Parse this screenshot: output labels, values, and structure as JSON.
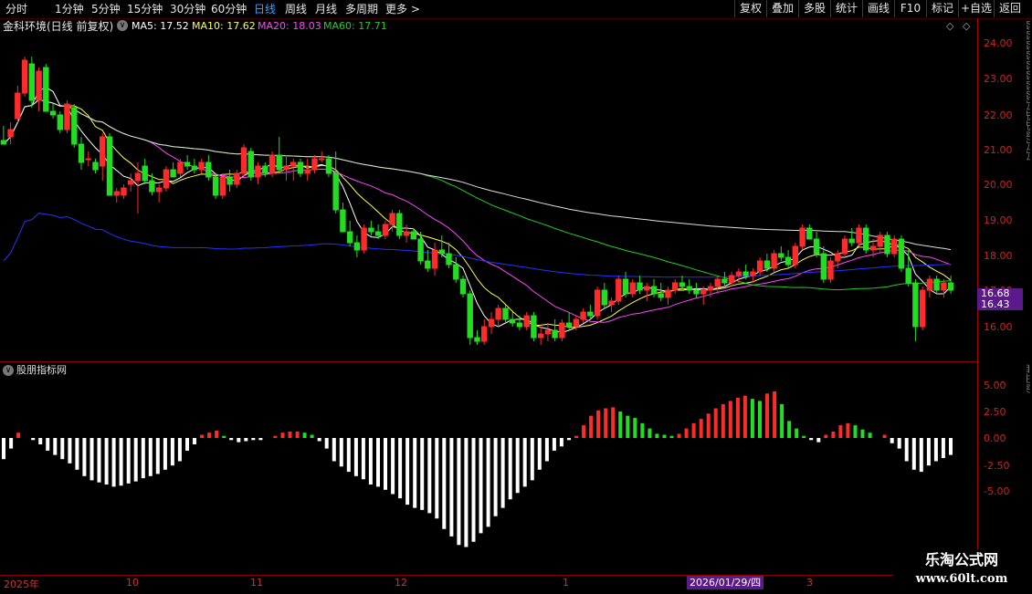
{
  "toolbar": {
    "tabs": [
      "分时",
      "1分钟",
      "5分钟",
      "15分钟",
      "30分钟",
      "60分钟",
      "日线",
      "周线",
      "月线",
      "多周期",
      "更多 >"
    ],
    "active_tab": "日线",
    "right_buttons": [
      "复权",
      "叠加",
      "多股",
      "统计",
      "画线",
      "F10",
      "标记",
      "+自选",
      "返回"
    ]
  },
  "info": {
    "title": "金科环境(日线 前复权)",
    "ma5": "MA5: 17.52",
    "ma10": "MA10: 17.62",
    "ma20": "MA20: 18.03",
    "ma60": "MA60: 17.71"
  },
  "colors": {
    "up": "#ff2a2a",
    "down": "#22dd22",
    "ma5": "#ffffff",
    "ma10": "#ffff44",
    "ma20": "#ff44ff",
    "ma60": "#22cc22",
    "long1": "#dddddd",
    "long2": "#2233ff",
    "axis": "#cc2222"
  },
  "price_axis": [
    "24.00",
    "23.00",
    "22.00",
    "21.00",
    "20.00",
    "19.00",
    "18.00",
    "17.00",
    "16.00"
  ],
  "price_tag": {
    "line1": "16.68",
    "line2": "16.43"
  },
  "indicator": {
    "title": "股朋指标网",
    "axis": [
      "5.00",
      "2.50",
      "0.00",
      "-2.50",
      "-5.00"
    ]
  },
  "x_axis": {
    "labels": [
      "2025年",
      "10",
      "11",
      "12",
      "1",
      "2026/01/29/四",
      "3"
    ]
  },
  "side_text": "套套套套套套套套拉洗洗突拉拉",
  "side_text2": "自注突",
  "logo": {
    "title": "乐淘公式网",
    "url": "www.60lt.com"
  },
  "chart_data": {
    "type": "candlestick",
    "ylim": [
      15.5,
      24.4
    ],
    "candles": [
      [
        21.5,
        21.9,
        21.4,
        21.4
      ],
      [
        21.6,
        22.0,
        21.4,
        21.8
      ],
      [
        22.1,
        23.0,
        22.0,
        22.8
      ],
      [
        22.8,
        23.8,
        22.7,
        23.7
      ],
      [
        23.6,
        23.8,
        22.4,
        22.6
      ],
      [
        22.6,
        23.5,
        22.3,
        23.4
      ],
      [
        23.5,
        23.6,
        22.3,
        22.3
      ],
      [
        22.3,
        22.5,
        22.1,
        22.2
      ],
      [
        22.2,
        22.3,
        21.7,
        21.8
      ],
      [
        21.8,
        22.6,
        21.7,
        22.5
      ],
      [
        22.4,
        22.5,
        21.3,
        21.4
      ],
      [
        21.4,
        21.6,
        20.7,
        20.9
      ],
      [
        21.0,
        21.2,
        20.8,
        21.0
      ],
      [
        20.9,
        21.0,
        20.6,
        20.7
      ],
      [
        20.8,
        21.7,
        20.4,
        21.6
      ],
      [
        21.6,
        21.7,
        20.0,
        20.0
      ],
      [
        20.0,
        20.2,
        19.8,
        20.1
      ],
      [
        20.0,
        20.3,
        19.9,
        20.2
      ],
      [
        20.3,
        20.6,
        20.1,
        20.4
      ],
      [
        20.4,
        20.9,
        19.5,
        20.6
      ],
      [
        20.8,
        21.0,
        20.3,
        20.4
      ],
      [
        20.4,
        20.6,
        20.0,
        20.1
      ],
      [
        20.1,
        20.3,
        19.8,
        20.2
      ],
      [
        20.2,
        20.8,
        20.1,
        20.7
      ],
      [
        20.7,
        20.9,
        20.5,
        20.5
      ],
      [
        20.6,
        21.0,
        20.5,
        20.9
      ],
      [
        20.9,
        21.1,
        20.7,
        20.8
      ],
      [
        20.8,
        21.0,
        20.6,
        20.7
      ],
      [
        20.7,
        21.0,
        20.6,
        20.9
      ],
      [
        20.9,
        21.1,
        20.4,
        20.5
      ],
      [
        20.5,
        20.6,
        19.9,
        20.0
      ],
      [
        20.0,
        20.6,
        19.9,
        20.5
      ],
      [
        20.5,
        20.7,
        20.1,
        20.3
      ],
      [
        20.3,
        20.7,
        20.2,
        20.6
      ],
      [
        20.6,
        21.4,
        20.5,
        21.3
      ],
      [
        21.2,
        21.3,
        20.4,
        20.5
      ],
      [
        20.5,
        20.9,
        20.3,
        20.8
      ],
      [
        20.8,
        20.9,
        20.5,
        20.6
      ],
      [
        20.6,
        21.2,
        20.5,
        21.1
      ],
      [
        21.1,
        21.6,
        20.6,
        20.7
      ],
      [
        20.7,
        21.1,
        20.4,
        20.8
      ],
      [
        20.8,
        21.0,
        20.4,
        20.9
      ],
      [
        20.9,
        21.0,
        20.5,
        20.6
      ],
      [
        20.6,
        21.0,
        20.4,
        20.7
      ],
      [
        20.7,
        21.1,
        20.6,
        21.0
      ],
      [
        21.0,
        21.2,
        20.9,
        21.0
      ],
      [
        21.0,
        21.1,
        20.5,
        20.6
      ],
      [
        20.6,
        21.2,
        19.5,
        19.6
      ],
      [
        19.6,
        19.8,
        19.1,
        19.0
      ],
      [
        19.0,
        19.3,
        18.6,
        18.7
      ],
      [
        18.7,
        18.9,
        18.3,
        18.5
      ],
      [
        18.5,
        19.2,
        18.4,
        19.1
      ],
      [
        19.1,
        19.3,
        18.9,
        19.0
      ],
      [
        19.0,
        19.2,
        18.8,
        18.9
      ],
      [
        18.9,
        19.3,
        18.8,
        19.2
      ],
      [
        19.2,
        19.6,
        19.0,
        19.5
      ],
      [
        19.5,
        19.6,
        18.8,
        18.9
      ],
      [
        18.9,
        19.2,
        18.7,
        19.0
      ],
      [
        19.0,
        19.1,
        18.8,
        18.8
      ],
      [
        18.8,
        19.0,
        18.1,
        18.2
      ],
      [
        18.2,
        18.5,
        17.9,
        18.0
      ],
      [
        18.0,
        18.7,
        17.8,
        18.5
      ],
      [
        18.5,
        18.9,
        18.3,
        18.4
      ],
      [
        18.4,
        18.7,
        18.0,
        18.1
      ],
      [
        18.1,
        18.3,
        17.6,
        17.7
      ],
      [
        17.7,
        17.8,
        17.2,
        17.3
      ],
      [
        17.3,
        17.4,
        15.9,
        16.1
      ],
      [
        16.1,
        16.3,
        15.9,
        16.0
      ],
      [
        16.0,
        16.6,
        15.9,
        16.4
      ],
      [
        16.4,
        16.8,
        16.2,
        16.6
      ],
      [
        16.6,
        17.0,
        16.4,
        16.9
      ],
      [
        16.9,
        17.0,
        16.5,
        16.6
      ],
      [
        16.6,
        16.8,
        16.4,
        16.5
      ],
      [
        16.5,
        16.7,
        16.3,
        16.4
      ],
      [
        16.4,
        16.8,
        16.3,
        16.7
      ],
      [
        16.7,
        16.8,
        16.0,
        16.1
      ],
      [
        16.1,
        16.4,
        15.9,
        16.2
      ],
      [
        16.2,
        16.5,
        16.0,
        16.3
      ],
      [
        16.3,
        16.6,
        16.0,
        16.1
      ],
      [
        16.1,
        16.6,
        16.0,
        16.5
      ],
      [
        16.5,
        16.8,
        16.3,
        16.4
      ],
      [
        16.4,
        16.7,
        16.3,
        16.6
      ],
      [
        16.6,
        16.9,
        16.5,
        16.8
      ],
      [
        16.8,
        17.0,
        16.6,
        16.7
      ],
      [
        16.7,
        17.5,
        16.6,
        17.4
      ],
      [
        17.4,
        17.6,
        16.9,
        17.0
      ],
      [
        17.0,
        17.2,
        16.8,
        17.1
      ],
      [
        17.1,
        17.8,
        17.0,
        17.7
      ],
      [
        17.7,
        17.9,
        17.2,
        17.3
      ],
      [
        17.3,
        17.7,
        17.2,
        17.6
      ],
      [
        17.6,
        17.8,
        17.3,
        17.4
      ],
      [
        17.4,
        17.6,
        17.1,
        17.5
      ],
      [
        17.5,
        17.7,
        17.2,
        17.3
      ],
      [
        17.3,
        17.6,
        17.1,
        17.2
      ],
      [
        17.2,
        17.5,
        17.0,
        17.4
      ],
      [
        17.4,
        17.7,
        17.3,
        17.6
      ],
      [
        17.6,
        17.8,
        17.4,
        17.5
      ],
      [
        17.5,
        17.7,
        17.3,
        17.4
      ],
      [
        17.4,
        17.6,
        17.2,
        17.3
      ],
      [
        17.3,
        17.5,
        17.0,
        17.4
      ],
      [
        17.4,
        17.6,
        17.2,
        17.5
      ],
      [
        17.5,
        17.8,
        17.3,
        17.7
      ],
      [
        17.7,
        17.9,
        17.5,
        17.6
      ],
      [
        17.6,
        17.9,
        17.5,
        17.8
      ],
      [
        17.8,
        18.0,
        17.6,
        17.9
      ],
      [
        17.9,
        18.1,
        17.7,
        17.8
      ],
      [
        17.8,
        18.0,
        17.6,
        17.9
      ],
      [
        17.9,
        18.3,
        17.8,
        18.2
      ],
      [
        18.2,
        18.4,
        17.9,
        18.0
      ],
      [
        18.0,
        18.5,
        17.9,
        18.4
      ],
      [
        18.4,
        18.6,
        18.2,
        18.3
      ],
      [
        18.3,
        18.5,
        18.0,
        18.1
      ],
      [
        18.1,
        18.7,
        18.0,
        18.6
      ],
      [
        18.6,
        19.2,
        18.5,
        19.1
      ],
      [
        19.1,
        19.2,
        18.8,
        18.8
      ],
      [
        18.8,
        19.0,
        18.3,
        18.4
      ],
      [
        18.4,
        18.6,
        17.6,
        17.7
      ],
      [
        17.7,
        18.3,
        17.6,
        18.2
      ],
      [
        18.2,
        18.5,
        18.0,
        18.4
      ],
      [
        18.4,
        18.9,
        18.3,
        18.8
      ],
      [
        18.8,
        19.1,
        18.6,
        18.7
      ],
      [
        18.7,
        19.2,
        18.6,
        19.1
      ],
      [
        19.1,
        19.2,
        18.4,
        18.5
      ],
      [
        18.5,
        18.8,
        18.3,
        18.6
      ],
      [
        18.6,
        19.0,
        18.4,
        18.9
      ],
      [
        18.9,
        19.0,
        18.3,
        18.4
      ],
      [
        18.4,
        18.9,
        18.3,
        18.8
      ],
      [
        18.8,
        18.9,
        17.9,
        18.0
      ],
      [
        18.0,
        18.5,
        17.5,
        17.6
      ],
      [
        17.6,
        17.7,
        16.0,
        16.4
      ],
      [
        16.4,
        17.5,
        16.3,
        17.4
      ],
      [
        17.4,
        17.8,
        17.2,
        17.7
      ],
      [
        17.7,
        17.8,
        17.3,
        17.4
      ],
      [
        17.4,
        17.7,
        17.2,
        17.6
      ],
      [
        17.6,
        17.8,
        17.3,
        17.4
      ]
    ],
    "macd": [
      -2.0,
      -1.0,
      0.5,
      0.0,
      -0.2,
      -0.6,
      -1.2,
      -1.6,
      -2.0,
      -2.4,
      -3.0,
      -3.6,
      -4.0,
      -4.2,
      -4.4,
      -4.6,
      -4.5,
      -4.3,
      -4.1,
      -3.8,
      -3.6,
      -3.4,
      -3.0,
      -2.6,
      -2.2,
      -1.2,
      -0.6,
      0.3,
      0.5,
      0.7,
      0.2,
      -0.2,
      -0.4,
      -0.3,
      -0.2,
      -0.2,
      0.0,
      0.2,
      0.5,
      0.6,
      0.6,
      0.5,
      0.3,
      -0.3,
      -1.0,
      -2.2,
      -2.7,
      -3.2,
      -3.6,
      -3.9,
      -4.4,
      -4.6,
      -4.9,
      -5.3,
      -5.7,
      -6.3,
      -6.6,
      -6.8,
      -7.1,
      -7.6,
      -8.6,
      -9.3,
      -10.1,
      -10.3,
      -9.8,
      -9.0,
      -8.4,
      -7.4,
      -6.6,
      -5.8,
      -5.2,
      -4.6,
      -4.0,
      -3.0,
      -2.2,
      -1.2,
      -0.8,
      -0.2,
      0.2,
      1.2,
      2.1,
      2.6,
      2.8,
      2.9,
      2.5,
      2.1,
      1.9,
      1.4,
      0.9,
      0.4,
      0.3,
      0.2,
      0.4,
      0.9,
      1.4,
      1.8,
      2.3,
      2.8,
      3.2,
      3.5,
      3.8,
      4.0,
      3.7,
      3.5,
      4.2,
      4.4,
      3.2,
      1.6,
      0.9,
      0.2,
      -0.2,
      -0.4,
      0.3,
      0.6,
      1.2,
      1.4,
      1.2,
      0.8,
      0.5,
      0.0,
      0.3,
      -0.5,
      -1.0,
      -2.2,
      -3.0,
      -3.2,
      -2.6,
      -2.2,
      -1.9,
      -1.6
    ]
  }
}
